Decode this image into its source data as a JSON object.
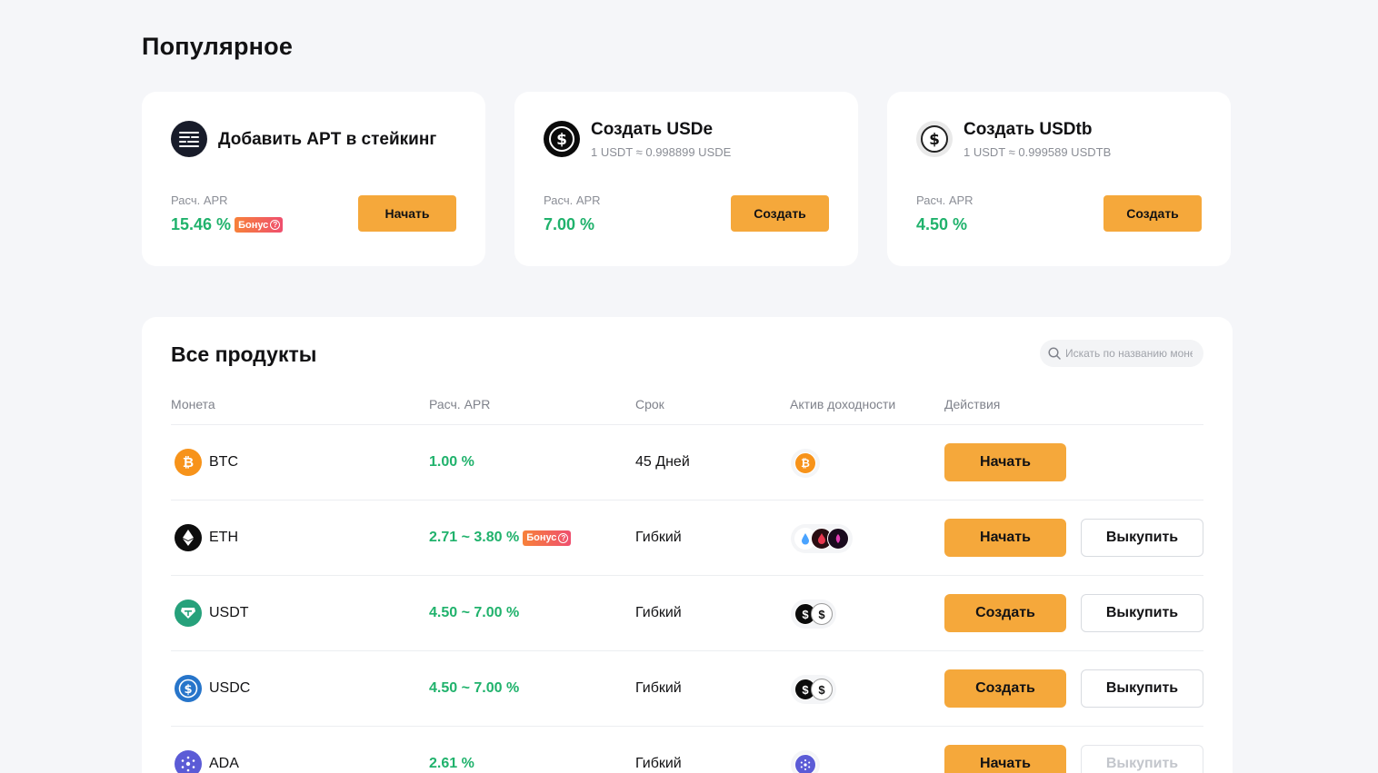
{
  "popular": {
    "title": "Популярное",
    "cards": [
      {
        "title": "Добавить APT в стейкинг",
        "subtitle": "",
        "apr_label": "Расч. APR",
        "apr": "15.46 %",
        "bonus": "Бонус",
        "button": "Начать",
        "icon": "aptos-icon"
      },
      {
        "title": "Создать USDe",
        "subtitle": "1 USDT ≈ 0.998899 USDE",
        "apr_label": "Расч. APR",
        "apr": "7.00 %",
        "bonus": "",
        "button": "Создать",
        "icon": "usde-icon"
      },
      {
        "title": "Создать USDtb",
        "subtitle": "1 USDT ≈ 0.999589 USDTB",
        "apr_label": "Расч. APR",
        "apr": "4.50 %",
        "bonus": "",
        "button": "Создать",
        "icon": "usdtb-icon"
      }
    ]
  },
  "products": {
    "title": "Все продукты",
    "search_placeholder": "Искать по названию монеты",
    "columns": [
      "Монета",
      "Расч. APR",
      "Срок",
      "Актив доходности",
      "Действия"
    ],
    "rows": [
      {
        "coin": "BTC",
        "apr": "1.00 %",
        "bonus": "",
        "term": "45 Дней",
        "action": "Начать",
        "redeem": ""
      },
      {
        "coin": "ETH",
        "apr": "2.71 ~ 3.80 %",
        "bonus": "Бонус",
        "term": "Гибкий",
        "action": "Начать",
        "redeem": "Выкупить"
      },
      {
        "coin": "USDT",
        "apr": "4.50 ~ 7.00 %",
        "bonus": "",
        "term": "Гибкий",
        "action": "Создать",
        "redeem": "Выкупить"
      },
      {
        "coin": "USDC",
        "apr": "4.50 ~ 7.00 %",
        "bonus": "",
        "term": "Гибкий",
        "action": "Создать",
        "redeem": "Выкупить"
      },
      {
        "coin": "ADA",
        "apr": "2.61 %",
        "bonus": "",
        "term": "Гибкий",
        "action": "Начать",
        "redeem": "Выкупить"
      }
    ]
  },
  "colors": {
    "accent": "#f5a83b",
    "positive": "#20b26c",
    "bonus_start": "#f7813a",
    "bonus_end": "#ef4f6e"
  }
}
